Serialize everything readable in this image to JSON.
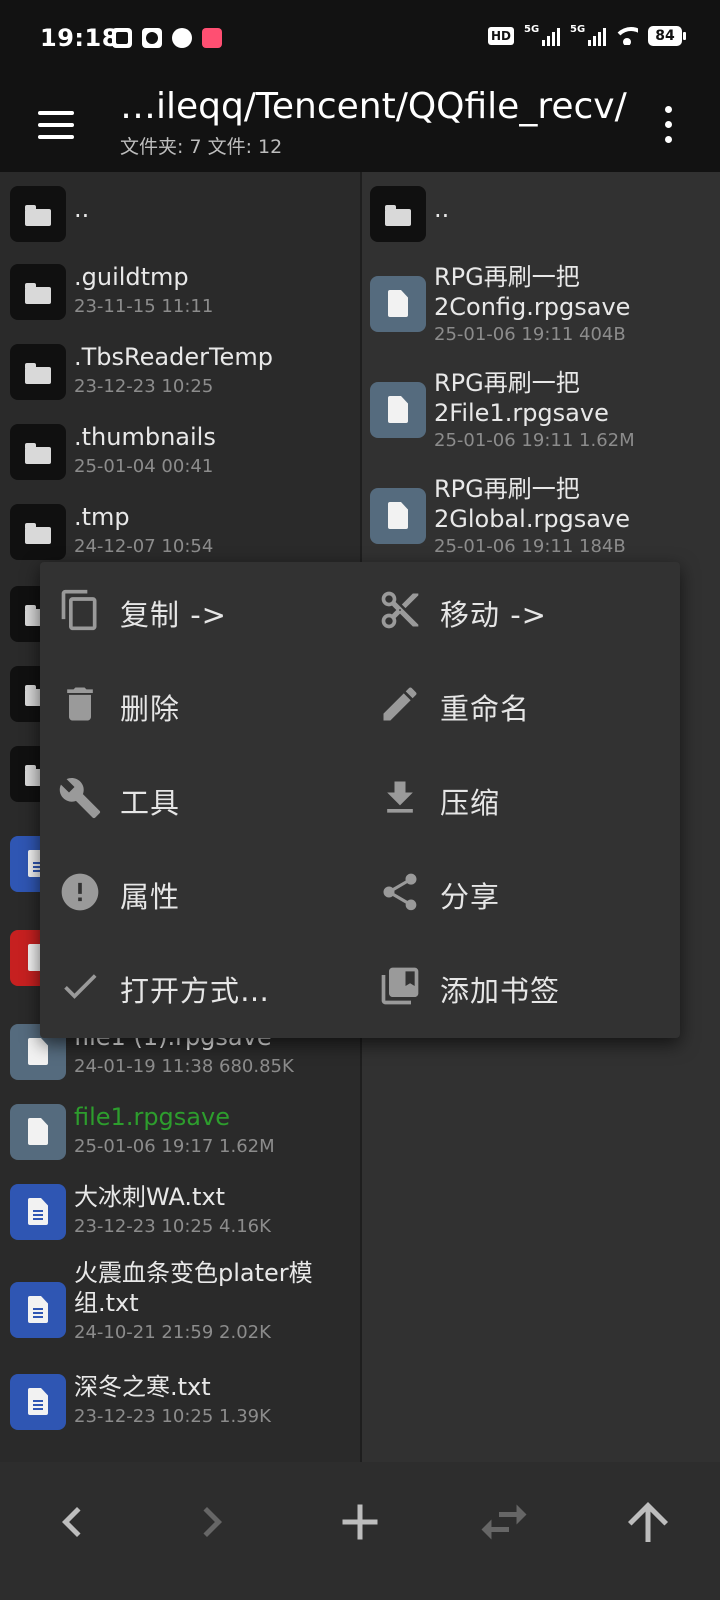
{
  "status_bar": {
    "time": "19:18",
    "battery": "84",
    "hd_label": "HD",
    "network_1": "5G",
    "network_2": "5G"
  },
  "app_bar": {
    "title": "…ileqq/Tencent/QQfile_recv/",
    "subtitle": "文件夹: 7  文件: 12"
  },
  "left_pane": {
    "items": [
      {
        "name": "..",
        "meta": "",
        "type": "folder"
      },
      {
        "name": ".guildtmp",
        "meta": "23-11-15 11:11",
        "type": "folder"
      },
      {
        "name": ".TbsReaderTemp",
        "meta": "23-12-23 10:25",
        "type": "folder"
      },
      {
        "name": ".thumbnails",
        "meta": "25-01-04 00:41",
        "type": "folder"
      },
      {
        "name": ".tmp",
        "meta": "24-12-07 10:54",
        "type": "folder"
      },
      {
        "name": "file1 (1).rpgsave",
        "meta": "24-01-19 11:38  680.85K",
        "type": "generic"
      },
      {
        "name": "file1.rpgsave",
        "meta": "25-01-06 19:17  1.62M",
        "type": "generic"
      },
      {
        "name": "大冰刺WA.txt",
        "meta": "23-12-23 10:25  4.16K",
        "type": "text"
      },
      {
        "name": "火震血条变色plater模组.txt",
        "meta": "24-10-21 21:59  2.02K",
        "type": "text"
      },
      {
        "name": "深冬之寒.txt",
        "meta": "23-12-23 10:25  1.39K",
        "type": "text"
      }
    ]
  },
  "right_pane": {
    "items": [
      {
        "name": "..",
        "meta": "",
        "type": "folder"
      },
      {
        "name": "RPG再刷一把2Config.rpgsave",
        "meta": "25-01-06 19:11  404B",
        "type": "generic"
      },
      {
        "name": "RPG再刷一把2File1.rpgsave",
        "meta": "25-01-06 19:11  1.62M",
        "type": "generic"
      },
      {
        "name": "RPG再刷一把2Global.rpgsave",
        "meta": "25-01-06 19:11  184B",
        "type": "generic"
      }
    ]
  },
  "context_menu": {
    "copy": "复制 ->",
    "move": "移动 ->",
    "delete": "删除",
    "rename": "重命名",
    "tools": "工具",
    "compress": "压缩",
    "properties": "属性",
    "share": "分享",
    "open_with": "打开方式…",
    "add_bookmark": "添加书签"
  },
  "colors": {
    "highlight_file": "#2d9d2d",
    "text_file_icon": "#2f56b3",
    "generic_file_icon": "#556b7e",
    "pdf_icon": "#c62020"
  },
  "icons": [
    "menu-icon",
    "more-vert-icon",
    "copy-icon",
    "scissors-icon",
    "trash-icon",
    "pencil-icon",
    "wrench-icon",
    "download-icon",
    "alert-icon",
    "share-icon",
    "check-icon",
    "bookmarks-icon",
    "back-icon",
    "forward-icon",
    "plus-icon",
    "swap-icon",
    "up-icon"
  ]
}
